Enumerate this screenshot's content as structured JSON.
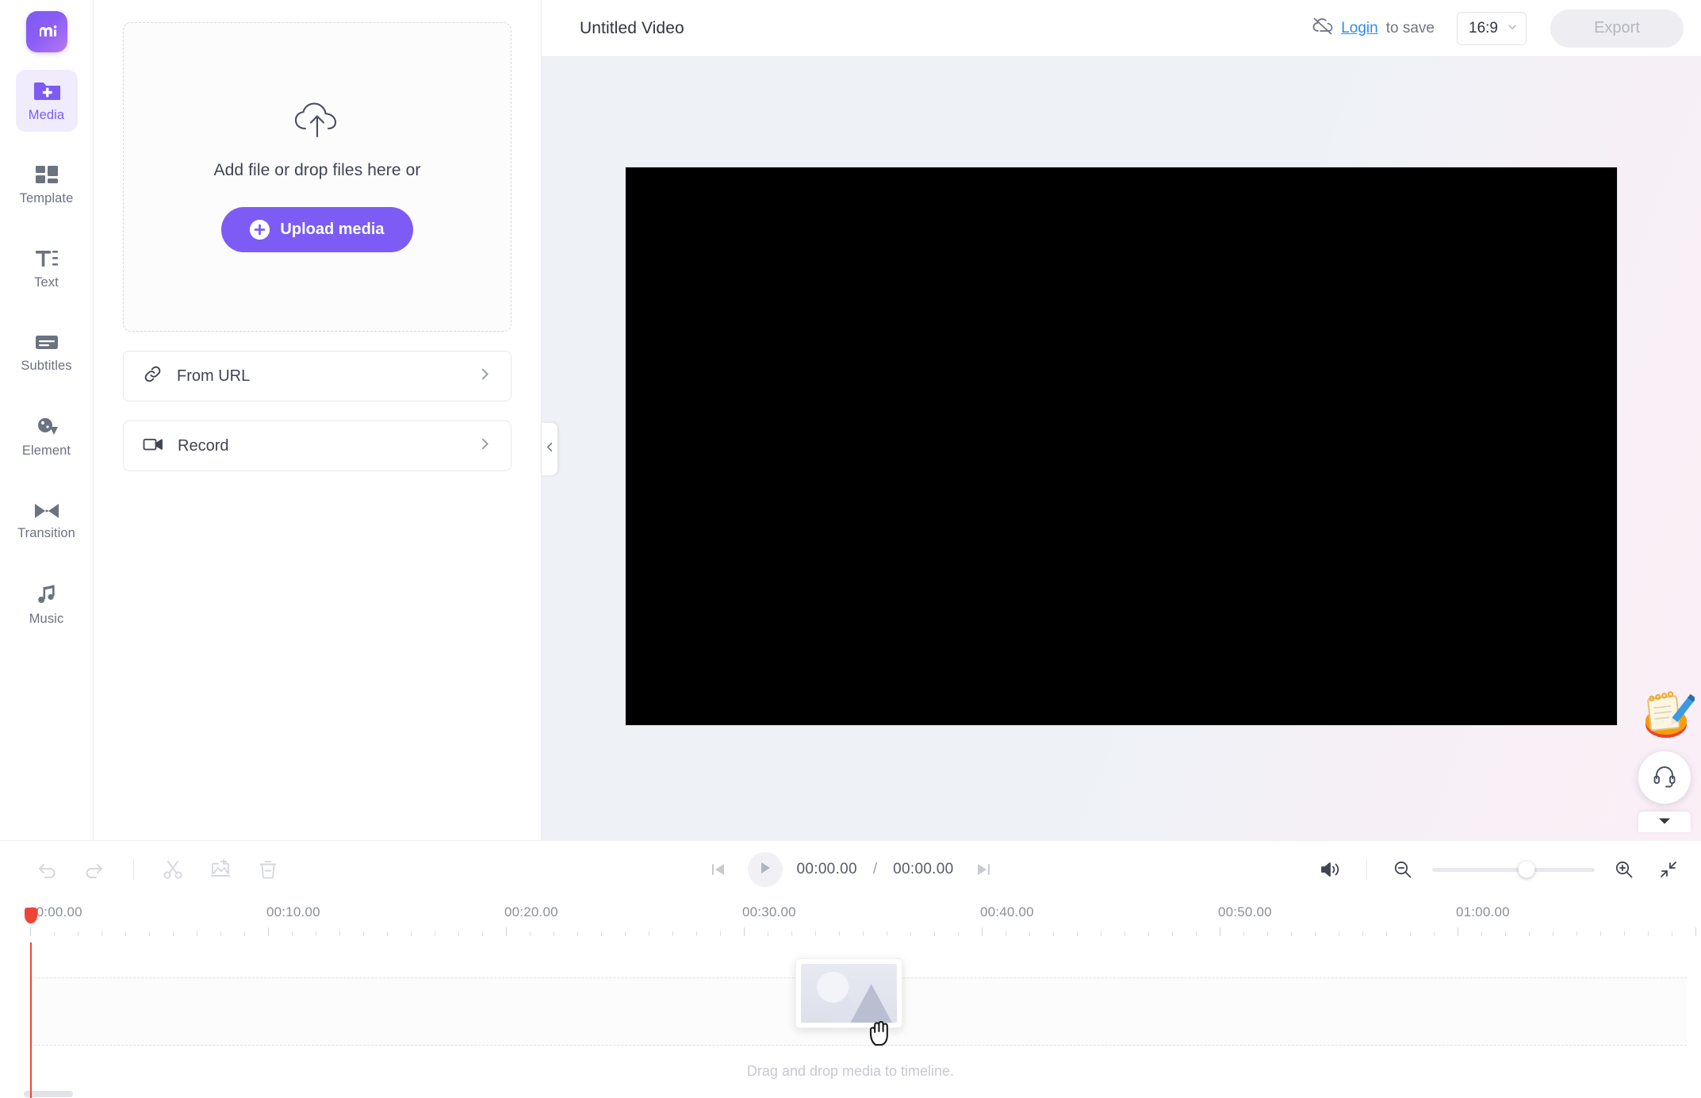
{
  "app": {
    "logo_icon": "mango-logo-icon"
  },
  "rail": {
    "items": [
      {
        "label": "Media",
        "icon": "folder-plus-icon",
        "active": true
      },
      {
        "label": "Template",
        "icon": "template-grid-icon",
        "active": false
      },
      {
        "label": "Text",
        "icon": "text-format-icon",
        "active": false
      },
      {
        "label": "Subtitles",
        "icon": "subtitles-icon",
        "active": false
      },
      {
        "label": "Element",
        "icon": "element-shapes-icon",
        "active": false
      },
      {
        "label": "Transition",
        "icon": "transition-icon",
        "active": false
      },
      {
        "label": "Music",
        "icon": "music-note-icon",
        "active": false
      }
    ]
  },
  "panel": {
    "dropzone": {
      "icon": "cloud-upload-icon",
      "text": "Add file or drop files here or",
      "upload_label": "Upload media",
      "upload_icon": "plus-circle-icon"
    },
    "rows": [
      {
        "label": "From URL",
        "icon": "link-icon",
        "chevron": "chevron-right-icon"
      },
      {
        "label": "Record",
        "icon": "video-camera-icon",
        "chevron": "chevron-right-icon"
      }
    ]
  },
  "header": {
    "title": "Untitled Video",
    "cloud_off_icon": "cloud-off-icon",
    "login_label": "Login",
    "save_suffix": "to save",
    "ratio_value": "16:9",
    "ratio_chevron": "chevron-down-icon",
    "export_label": "Export"
  },
  "stage": {
    "collapse_icon": "chevron-left-icon",
    "feedback_icon": "notepad-pencil-icon",
    "support_icon": "headset-icon",
    "collapse_down_icon": "caret-down-icon"
  },
  "timeline": {
    "tools": [
      {
        "name": "undo",
        "icon": "undo-icon"
      },
      {
        "name": "redo",
        "icon": "redo-icon"
      },
      {
        "name": "split",
        "icon": "scissors-icon"
      },
      {
        "name": "add-media",
        "icon": "add-image-icon"
      },
      {
        "name": "delete",
        "icon": "trash-icon"
      }
    ],
    "transport": {
      "prev_icon": "skip-previous-icon",
      "play_icon": "play-icon",
      "next_icon": "skip-next-icon",
      "current_time": "00:00.00",
      "separator": "/",
      "total_time": "00:00.00"
    },
    "right_tools": {
      "volume_icon": "volume-icon",
      "zoom_out_icon": "zoom-out-icon",
      "zoom_in_icon": "zoom-in-icon",
      "fit_icon": "collapse-arrows-icon",
      "zoom_value": 58
    },
    "ruler": {
      "labels": [
        "00:00.00",
        "00:10.00",
        "00:20.00",
        "00:30.00",
        "00:40.00",
        "00:50.00",
        "01:00.00"
      ],
      "positions": [
        38,
        338,
        638,
        938,
        1238,
        1538,
        1838
      ],
      "spacing_px": 300,
      "minor_per_major": 10
    },
    "drop_hint": "Drag and drop media to timeline.",
    "ghost_thumb_icon": "image-placeholder-icon",
    "cursor_icon": "grab-hand-cursor"
  },
  "colors": {
    "accent": "#7c5cf5",
    "accent_soft": "#f0ecfe",
    "link": "#2b8cf0",
    "playhead": "#f04438",
    "text": "#3f4451",
    "muted": "#8a9099",
    "video_bg": "#000000"
  }
}
